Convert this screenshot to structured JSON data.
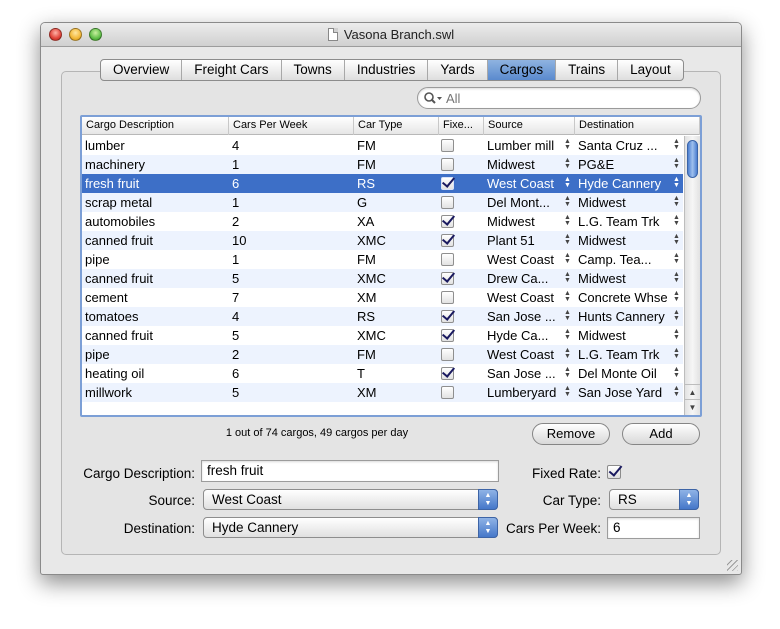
{
  "window": {
    "title": "Vasona Branch.swl"
  },
  "tabs": [
    "Overview",
    "Freight Cars",
    "Towns",
    "Industries",
    "Yards",
    "Cargos",
    "Trains",
    "Layout"
  ],
  "selected_tab": "Cargos",
  "search": {
    "placeholder": "All"
  },
  "table": {
    "columns": [
      "Cargo Description",
      "Cars Per Week",
      "Car Type",
      "Fixe...",
      "Source",
      "Destination"
    ],
    "rows": [
      {
        "desc": "lumber",
        "cars": "4",
        "type": "FM",
        "fixed": false,
        "source": "Lumber mill",
        "dest": "Santa Cruz ..."
      },
      {
        "desc": "machinery",
        "cars": "1",
        "type": "FM",
        "fixed": false,
        "source": "Midwest",
        "dest": "PG&E"
      },
      {
        "desc": "fresh fruit",
        "cars": "6",
        "type": "RS",
        "fixed": true,
        "source": "West Coast",
        "dest": "Hyde Cannery"
      },
      {
        "desc": "scrap metal",
        "cars": "1",
        "type": "G",
        "fixed": false,
        "source": "Del Mont...",
        "dest": "Midwest"
      },
      {
        "desc": "automobiles",
        "cars": "2",
        "type": "XA",
        "fixed": true,
        "source": "Midwest",
        "dest": "L.G. Team Trk"
      },
      {
        "desc": "canned fruit",
        "cars": "10",
        "type": "XMC",
        "fixed": true,
        "source": "Plant 51",
        "dest": "Midwest"
      },
      {
        "desc": "pipe",
        "cars": "1",
        "type": "FM",
        "fixed": false,
        "source": "West Coast",
        "dest": "Camp. Tea..."
      },
      {
        "desc": "canned fruit",
        "cars": "5",
        "type": "XMC",
        "fixed": true,
        "source": "Drew Ca...",
        "dest": "Midwest"
      },
      {
        "desc": "cement",
        "cars": "7",
        "type": "XM",
        "fixed": false,
        "source": "West Coast",
        "dest": "Concrete Whse"
      },
      {
        "desc": "tomatoes",
        "cars": "4",
        "type": "RS",
        "fixed": true,
        "source": "San Jose ...",
        "dest": "Hunts Cannery"
      },
      {
        "desc": "canned fruit",
        "cars": "5",
        "type": "XMC",
        "fixed": true,
        "source": "Hyde Ca...",
        "dest": "Midwest"
      },
      {
        "desc": "pipe",
        "cars": "2",
        "type": "FM",
        "fixed": false,
        "source": "West Coast",
        "dest": "L.G. Team Trk"
      },
      {
        "desc": "heating oil",
        "cars": "6",
        "type": "T",
        "fixed": true,
        "source": "San Jose ...",
        "dest": "Del Monte Oil"
      },
      {
        "desc": "millwork",
        "cars": "5",
        "type": "XM",
        "fixed": false,
        "source": "Lumberyard",
        "dest": "San Jose Yard"
      }
    ],
    "selected_index": 2
  },
  "status_text": "1 out of 74 cargos, 49 cargos per day",
  "buttons": {
    "remove": "Remove",
    "add": "Add"
  },
  "form": {
    "cargo_description_label": "Cargo Description:",
    "cargo_description_value": "fresh fruit",
    "source_label": "Source:",
    "source_value": "West Coast",
    "destination_label": "Destination:",
    "destination_value": "Hyde Cannery",
    "fixed_rate_label": "Fixed Rate:",
    "fixed_rate_checked": true,
    "car_type_label": "Car Type:",
    "car_type_value": "RS",
    "cars_per_week_label": "Cars Per Week:",
    "cars_per_week_value": "6"
  },
  "colors": {
    "selection": "#3d6fc7",
    "alt_row": "#edf3fe",
    "focus_ring": "#7c9fd6"
  },
  "icons": [
    "close-button-icon",
    "minimize-button-icon",
    "zoom-button-icon",
    "document-icon",
    "search-icon",
    "checkmark-icon",
    "stepper-arrows-icon",
    "resize-grip-icon"
  ]
}
